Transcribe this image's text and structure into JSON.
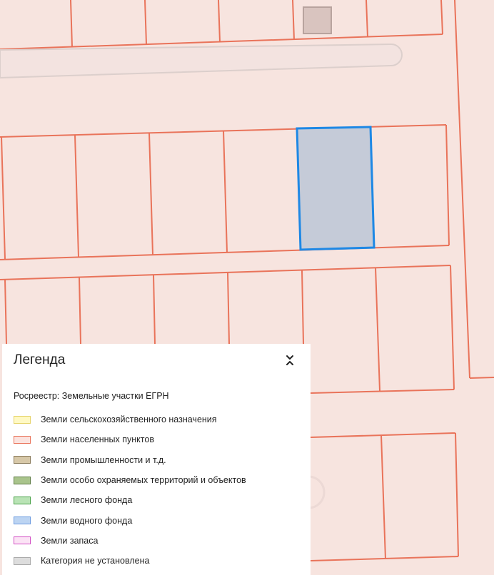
{
  "map": {
    "colors": {
      "background": "#f7e4df",
      "parcel_border": "#e9735a",
      "selected_fill": "#c5cbd8",
      "selected_border": "#1e88e5",
      "road_fill": "#f3e3e0",
      "road_border": "#dccfcc",
      "building": "#d9c4bf"
    }
  },
  "legend": {
    "title": "Легенда",
    "toggle_icon": "chevrons-collapse-icon",
    "layer_title": "Росреестр: Земельные участки ЕГРН",
    "items": [
      {
        "label": "Земли сельскохозяйственного назначения",
        "fill": "#fff9c4",
        "border": "#e6d36a"
      },
      {
        "label": "Земли населенных пунктов",
        "fill": "#fbe3df",
        "border": "#e9735a"
      },
      {
        "label": "Земли промышленности и т.д.",
        "fill": "#d7c8a8",
        "border": "#8a7a5a"
      },
      {
        "label": "Земли особо охраняемых территорий и объектов",
        "fill": "#a9c48c",
        "border": "#5f7d45"
      },
      {
        "label": "Земли лесного фонда",
        "fill": "#b9e3b5",
        "border": "#49a248"
      },
      {
        "label": "Земли водного фонда",
        "fill": "#bcd4f2",
        "border": "#6d9be0"
      },
      {
        "label": "Земли запаса",
        "fill": "#fbe3f5",
        "border": "#d24fc4"
      },
      {
        "label": "Категория не установлена",
        "fill": "#dddddd",
        "border": "#aaaaaa"
      }
    ]
  }
}
